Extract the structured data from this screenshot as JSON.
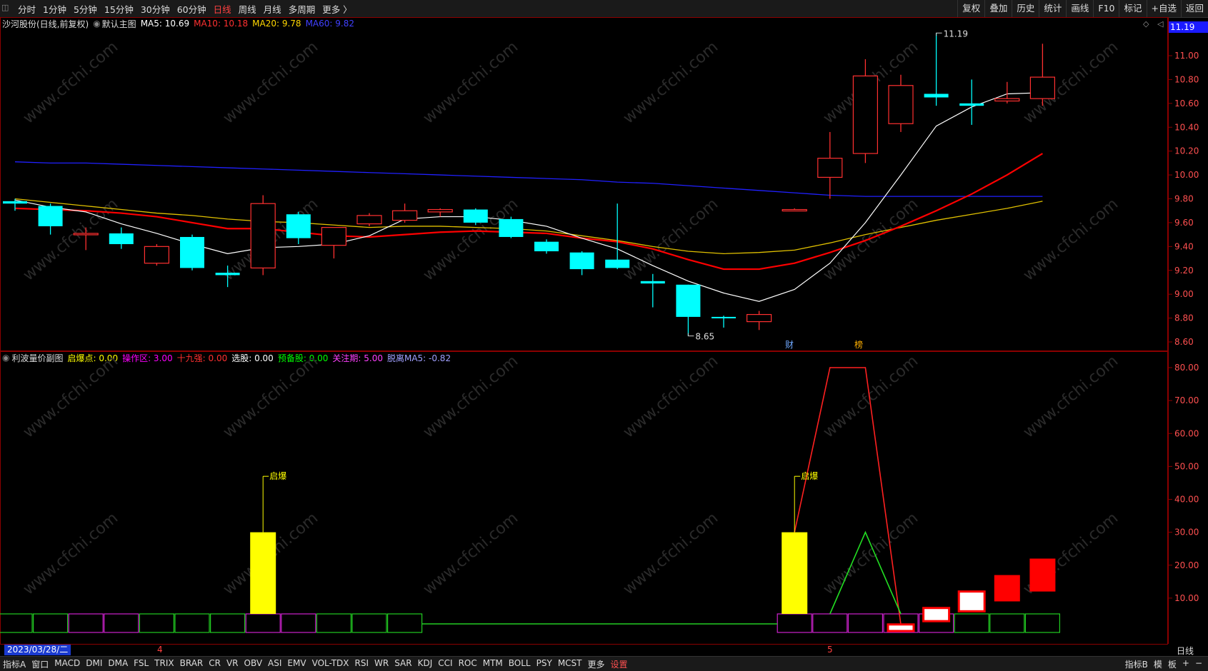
{
  "toolbar": {
    "back_icon": "back-icon",
    "periods": [
      "分时",
      "1分钟",
      "5分钟",
      "15分钟",
      "30分钟",
      "60分钟",
      "日线",
      "周线",
      "月线",
      "多周期",
      "更多 〉"
    ],
    "active_period": "日线",
    "right_buttons": [
      "复权",
      "叠加",
      "历史",
      "统计",
      "画线",
      "F10",
      "标记",
      "+自选",
      "返回"
    ]
  },
  "main_panel": {
    "stock_label": "沙河股份(日线,前复权)",
    "chart_label": "默认主图",
    "ma5": "MA5: 10.69",
    "ma10": "MA10: 10.18",
    "ma20": "MA20: 9.78",
    "ma60": "MA60: 9.82",
    "top_price_tag": "11.19",
    "ticks": [
      "11.00",
      "10.80",
      "10.60",
      "10.40",
      "10.20",
      "10.00",
      "9.80",
      "9.60",
      "9.40",
      "9.20",
      "9.00",
      "8.80",
      "8.60"
    ],
    "high_marker": "11.19",
    "low_marker": "8.65",
    "badge_finance": "财",
    "badge_rank": "榜",
    "colors": {
      "up": "#ff3030",
      "down": "#00ffff",
      "ma5": "#ffffff",
      "ma10": "#ff0000",
      "ma20": "#e0c000",
      "ma60": "#2020ff"
    }
  },
  "sub_panel": {
    "title": "利波量价副图",
    "items": [
      {
        "label": "启爆点: 0.00",
        "color": "#ffff00"
      },
      {
        "label": "操作区: 3.00",
        "color": "#ff00ff"
      },
      {
        "label": "十九强: 0.00",
        "color": "#ff3030"
      },
      {
        "label": "选股: 0.00",
        "color": "#ffffff"
      },
      {
        "label": "预备股: 0.00",
        "color": "#00ff00"
      },
      {
        "label": "关注期: 5.00",
        "color": "#ff40ff"
      },
      {
        "label": "脱离MA5: -0.82",
        "color": "#a0a0ff"
      }
    ],
    "ticks": [
      "80.00",
      "70.00",
      "60.00",
      "50.00",
      "40.00",
      "30.00",
      "20.00",
      "10.00"
    ],
    "marker_label": "启爆"
  },
  "x_axis": {
    "date": "2023/03/28/二",
    "month_4": "4",
    "month_5": "5",
    "period_label": "日线"
  },
  "statusbar": {
    "items": [
      "指标A",
      "窗口",
      "MACD",
      "DMI",
      "DMA",
      "FSL",
      "TRIX",
      "BRAR",
      "CR",
      "VR",
      "OBV",
      "ASI",
      "EMV",
      "VOL-TDX",
      "RSI",
      "WR",
      "SAR",
      "KDJ",
      "CCI",
      "ROC",
      "MTM",
      "BOLL",
      "PSY",
      "MCST",
      "更多",
      "设置"
    ],
    "active": "设置",
    "right_items": [
      "指标B",
      "模",
      "板",
      "+",
      "−"
    ]
  },
  "watermark": "www.cfchi.com",
  "chart_data": [
    {
      "type": "candlestick",
      "title": "沙河股份(日线,前复权)",
      "ylim": [
        8.55,
        11.19
      ],
      "candles": [
        {
          "o": 9.78,
          "h": 9.8,
          "l": 9.7,
          "c": 9.76
        },
        {
          "o": 9.74,
          "h": 9.76,
          "l": 9.5,
          "c": 9.57
        },
        {
          "o": 9.51,
          "h": 9.56,
          "l": 9.37,
          "c": 9.51
        },
        {
          "o": 9.51,
          "h": 9.56,
          "l": 9.38,
          "c": 9.42
        },
        {
          "o": 9.26,
          "h": 9.42,
          "l": 9.24,
          "c": 9.4
        },
        {
          "o": 9.48,
          "h": 9.5,
          "l": 9.2,
          "c": 9.22
        },
        {
          "o": 9.18,
          "h": 9.24,
          "l": 9.06,
          "c": 9.16
        },
        {
          "o": 9.22,
          "h": 9.83,
          "l": 9.16,
          "c": 9.76
        },
        {
          "o": 9.67,
          "h": 9.69,
          "l": 9.42,
          "c": 9.47
        },
        {
          "o": 9.41,
          "h": 9.56,
          "l": 9.3,
          "c": 9.56
        },
        {
          "o": 9.59,
          "h": 9.68,
          "l": 9.57,
          "c": 9.66
        },
        {
          "o": 9.62,
          "h": 9.76,
          "l": 9.6,
          "c": 9.7
        },
        {
          "o": 9.69,
          "h": 9.72,
          "l": 9.65,
          "c": 9.71
        },
        {
          "o": 9.71,
          "h": 9.72,
          "l": 9.58,
          "c": 9.6
        },
        {
          "o": 9.63,
          "h": 9.65,
          "l": 9.47,
          "c": 9.48
        },
        {
          "o": 9.44,
          "h": 9.46,
          "l": 9.34,
          "c": 9.36
        },
        {
          "o": 9.35,
          "h": 9.36,
          "l": 9.16,
          "c": 9.21
        },
        {
          "o": 9.29,
          "h": 9.76,
          "l": 9.21,
          "c": 9.22
        },
        {
          "o": 9.11,
          "h": 9.17,
          "l": 8.89,
          "c": 9.09
        },
        {
          "o": 9.08,
          "h": 9.08,
          "l": 8.65,
          "c": 8.81
        },
        {
          "o": 8.81,
          "h": 8.82,
          "l": 8.72,
          "c": 8.8
        },
        {
          "o": 8.77,
          "h": 8.86,
          "l": 8.7,
          "c": 8.83
        },
        {
          "o": 9.71,
          "h": 9.72,
          "l": 9.71,
          "c": 9.71
        },
        {
          "o": 9.98,
          "h": 10.36,
          "l": 9.8,
          "c": 10.14
        },
        {
          "o": 10.18,
          "h": 10.97,
          "l": 10.1,
          "c": 10.83
        },
        {
          "o": 10.43,
          "h": 10.84,
          "l": 10.36,
          "c": 10.75
        },
        {
          "o": 10.68,
          "h": 11.19,
          "l": 10.58,
          "c": 10.65
        },
        {
          "o": 10.6,
          "h": 10.8,
          "l": 10.42,
          "c": 10.58
        },
        {
          "o": 10.62,
          "h": 10.78,
          "l": 10.6,
          "c": 10.64
        },
        {
          "o": 10.64,
          "h": 11.1,
          "l": 10.58,
          "c": 10.82
        }
      ],
      "ma5": [
        9.79,
        9.73,
        9.69,
        9.59,
        9.51,
        9.42,
        9.34,
        9.39,
        9.4,
        9.42,
        9.49,
        9.63,
        9.65,
        9.65,
        9.62,
        9.57,
        9.47,
        9.38,
        9.24,
        9.11,
        9.01,
        8.94,
        9.04,
        9.26,
        9.6,
        10.0,
        10.41,
        10.57,
        10.68,
        10.69
      ],
      "ma10": [
        9.72,
        9.71,
        9.7,
        9.68,
        9.65,
        9.6,
        9.55,
        9.55,
        9.52,
        9.49,
        9.48,
        9.5,
        9.52,
        9.53,
        9.52,
        9.51,
        9.47,
        9.44,
        9.38,
        9.29,
        9.21,
        9.21,
        9.26,
        9.35,
        9.45,
        9.57,
        9.7,
        9.84,
        10.0,
        10.18
      ],
      "ma20": [
        9.8,
        9.77,
        9.74,
        9.71,
        9.68,
        9.66,
        9.63,
        9.61,
        9.6,
        9.58,
        9.56,
        9.57,
        9.57,
        9.56,
        9.55,
        9.53,
        9.49,
        9.45,
        9.4,
        9.36,
        9.34,
        9.35,
        9.37,
        9.43,
        9.5,
        9.56,
        9.62,
        9.67,
        9.72,
        9.78
      ],
      "ma60": [
        10.11,
        10.1,
        10.1,
        10.09,
        10.08,
        10.07,
        10.06,
        10.05,
        10.04,
        10.03,
        10.02,
        10.01,
        10.0,
        9.99,
        9.98,
        9.97,
        9.96,
        9.94,
        9.93,
        9.91,
        9.89,
        9.87,
        9.85,
        9.83,
        9.82,
        9.82,
        9.82,
        9.82,
        9.82,
        9.82
      ]
    },
    {
      "type": "bar",
      "title": "利波量价副图",
      "ylim": [
        -5,
        85
      ],
      "yellow_bars": [
        {
          "index": 7,
          "value": 30
        },
        {
          "index": 22,
          "value": 30
        }
      ],
      "red_line": [
        {
          "index": 22,
          "value": 30
        },
        {
          "index": 23,
          "value": 80
        },
        {
          "index": 24,
          "value": 80
        },
        {
          "index": 25,
          "value": 2
        }
      ],
      "green_line": [
        {
          "index": 23,
          "value": 0
        },
        {
          "index": 24,
          "value": 30
        },
        {
          "index": 25,
          "value": 0
        }
      ],
      "red_boxes": [
        {
          "index": 25,
          "low": 0,
          "high": 2,
          "filled": false
        },
        {
          "index": 26,
          "low": 3,
          "high": 7,
          "filled": false
        },
        {
          "index": 27,
          "low": 6,
          "high": 12,
          "filled": false
        },
        {
          "index": 28,
          "low": 9,
          "high": 17,
          "filled": true
        },
        {
          "index": 29,
          "low": 12,
          "high": 22,
          "filled": true
        }
      ],
      "baseline_boxes": [
        {
          "from": 0,
          "to": 11,
          "colors": [
            "g",
            "g",
            "m",
            "m",
            "g",
            "g",
            "g",
            "m",
            "m",
            "g",
            "g",
            "g"
          ]
        },
        {
          "from": 22,
          "to": 29,
          "colors": [
            "m",
            "m",
            "m",
            "m",
            "m",
            "g",
            "g",
            "g"
          ]
        }
      ],
      "annotations": [
        {
          "index": 7,
          "label": "启爆"
        },
        {
          "index": 22,
          "label": "启爆"
        }
      ]
    }
  ]
}
